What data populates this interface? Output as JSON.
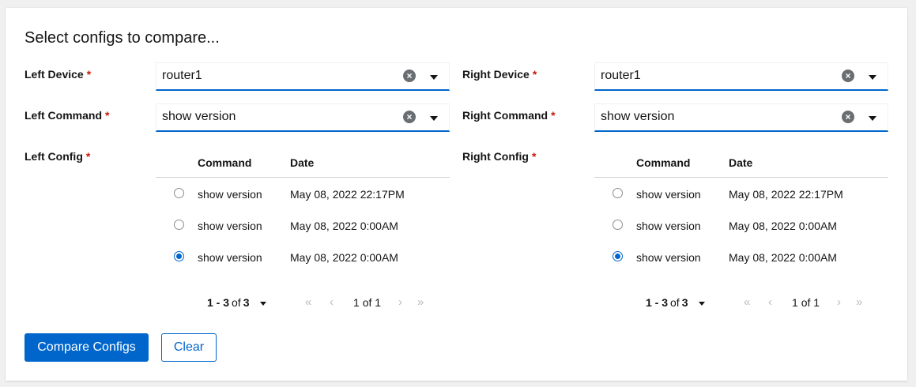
{
  "title": "Select configs to compare...",
  "required_marker": "*",
  "left": {
    "device_label": "Left Device",
    "device_value": "router1",
    "command_label": "Left Command",
    "command_value": "show version",
    "config_label": "Left Config",
    "columns": [
      "Command",
      "Date"
    ],
    "rows": [
      {
        "command": "show version",
        "date": "May 08, 2022 22:17PM",
        "selected": false
      },
      {
        "command": "show version",
        "date": "May 08, 2022 0:00AM",
        "selected": false
      },
      {
        "command": "show version",
        "date": "May 08, 2022 0:00AM",
        "selected": true
      }
    ],
    "pagination": {
      "range": "1 - 3",
      "of": "of",
      "total": "3",
      "page": "1",
      "page_of": "of 1"
    }
  },
  "right": {
    "device_label": "Right Device",
    "device_value": "router1",
    "command_label": "Right Command",
    "command_value": "show version",
    "config_label": "Right Config",
    "columns": [
      "Command",
      "Date"
    ],
    "rows": [
      {
        "command": "show version",
        "date": "May 08, 2022 22:17PM",
        "selected": false
      },
      {
        "command": "show version",
        "date": "May 08, 2022 0:00AM",
        "selected": false
      },
      {
        "command": "show version",
        "date": "May 08, 2022 0:00AM",
        "selected": true
      }
    ],
    "pagination": {
      "range": "1 - 3",
      "of": "of",
      "total": "3",
      "page": "1",
      "page_of": "of 1"
    }
  },
  "buttons": {
    "compare_label": "Compare Configs",
    "clear_label": "Clear"
  },
  "icons": {
    "clear": "times-circle-icon",
    "caret": "caret-down-icon",
    "first": "angle-double-left-icon",
    "prev": "angle-left-icon",
    "next": "angle-right-icon",
    "last": "angle-double-right-icon"
  },
  "colors": {
    "accent": "#0066cc",
    "required": "#c9190b"
  }
}
